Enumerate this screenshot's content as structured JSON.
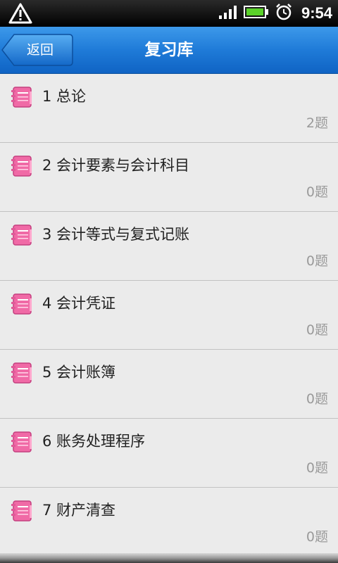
{
  "status_bar": {
    "time": "9:54",
    "icons": [
      "warning-icon",
      "signal-icon",
      "battery-icon",
      "alarm-icon"
    ]
  },
  "header": {
    "back_label": "返回",
    "title": "复习库"
  },
  "items": [
    {
      "title": "1 总论",
      "count": "2题"
    },
    {
      "title": "2 会计要素与会计科目",
      "count": "0题"
    },
    {
      "title": "3 会计等式与复式记账",
      "count": "0题"
    },
    {
      "title": "4 会计凭证",
      "count": "0题"
    },
    {
      "title": "5 会计账簿",
      "count": "0题"
    },
    {
      "title": "6 账务处理程序",
      "count": "0题"
    },
    {
      "title": "7 财产清查",
      "count": "0题"
    }
  ],
  "colors": {
    "header_blue": "#1f7bd8",
    "list_bg": "#ebebeb",
    "count_gray": "#9a9a9a",
    "icon_pink": "#f06aa6"
  }
}
